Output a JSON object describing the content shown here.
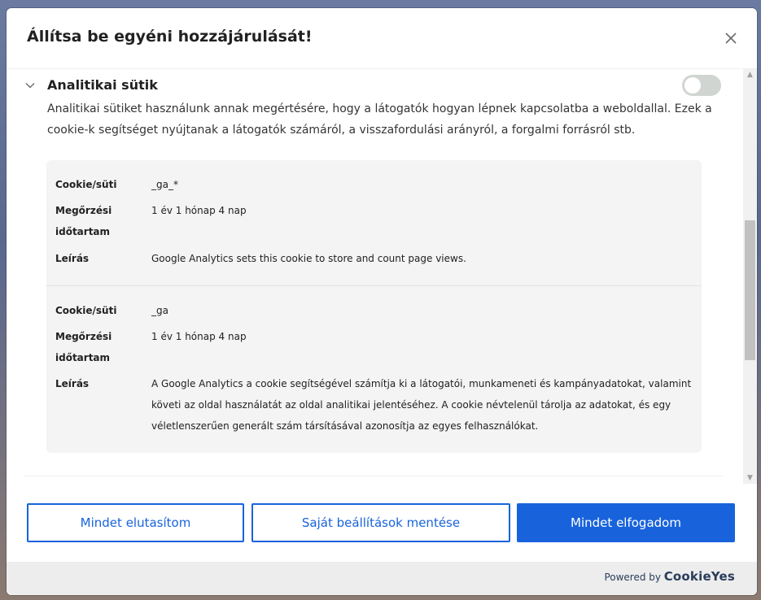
{
  "modal": {
    "title": "Állítsa be egyéni hozzájárulását!",
    "close_icon": "close-icon"
  },
  "category": {
    "title": "Analitikai sütik",
    "enabled": false,
    "description": "Analitikai sütiket használunk annak megértésére, hogy a látogatók hogyan lépnek kapcsolatba a weboldallal. Ezek a cookie-k segítséget nyújtanak a látogatók számáról, a visszafordulási arányról, a forgalmi forrásról stb.",
    "cookies": [
      {
        "name_label": "Cookie/süti",
        "name": "_ga_*",
        "duration_label": "Megőrzési időtartam",
        "duration": "1 év 1 hónap 4 nap",
        "desc_label": "Leírás",
        "desc": "Google Analytics sets this cookie to store and count page views."
      },
      {
        "name_label": "Cookie/süti",
        "name": "_ga",
        "duration_label": "Megőrzési időtartam",
        "duration": "1 év 1 hónap 4 nap",
        "desc_label": "Leírás",
        "desc": "A Google Analytics a cookie segítségével számítja ki a látogatói, munkameneti és kampányadatokat, valamint követi az oldal használatát az oldal analitikai jelentéséhez. A cookie névtelenül tárolja az adatokat, és egy véletlenszerűen generált szám társításával azonosítja az egyes felhasználókat."
      }
    ]
  },
  "buttons": {
    "reject": "Mindet elutasítom",
    "save": "Saját beállítások mentése",
    "accept": "Mindet elfogadom"
  },
  "footer": {
    "powered_by": "Powered by",
    "brand": "CookieYes"
  },
  "colors": {
    "accent": "#1863dc",
    "toggle_off": "#d0d5d2",
    "table_bg": "#f4f4f4",
    "footer_bg": "#ededed"
  }
}
